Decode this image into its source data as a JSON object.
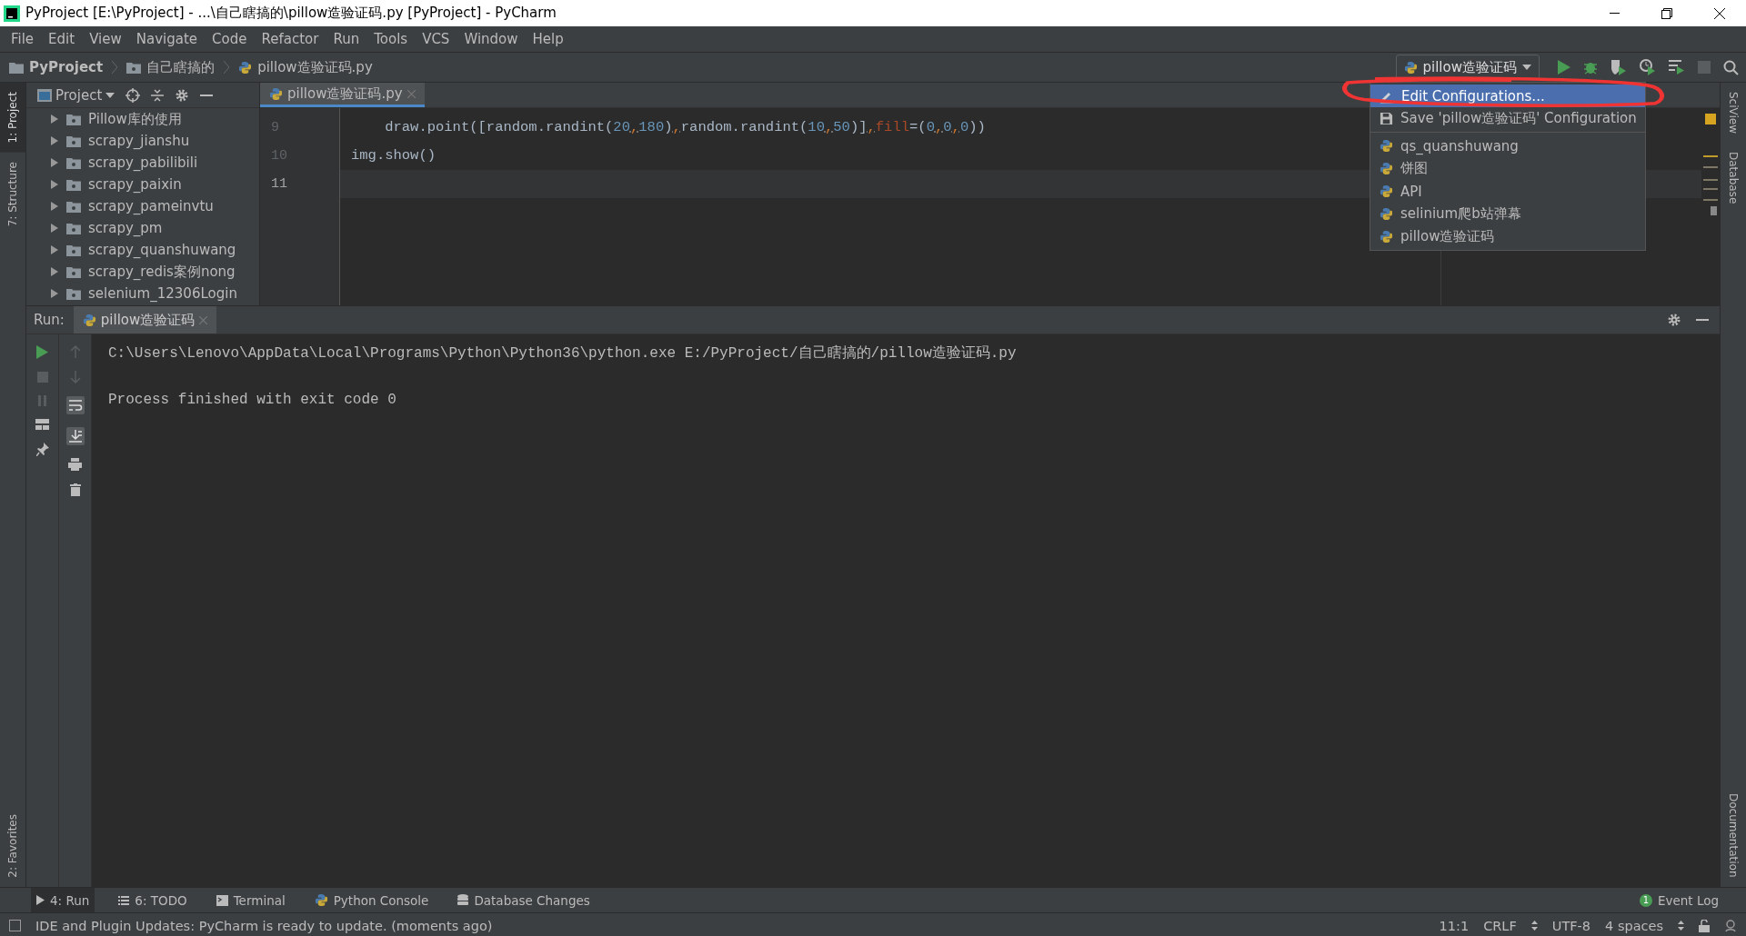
{
  "window": {
    "title": "PyProject [E:\\PyProject] - ...\\自己瞎搞的\\pillow造验证码.py [PyProject] - PyCharm"
  },
  "menu": [
    "File",
    "Edit",
    "View",
    "Navigate",
    "Code",
    "Refactor",
    "Run",
    "Tools",
    "VCS",
    "Window",
    "Help"
  ],
  "breadcrumb": [
    {
      "label": "PyProject",
      "kind": "project"
    },
    {
      "label": "自己瞎搞的",
      "kind": "folder"
    },
    {
      "label": "pillow造验证码.py",
      "kind": "file"
    }
  ],
  "run_config": {
    "label": "pillow造验证码"
  },
  "config_menu": [
    {
      "label": "Edit Configurations...",
      "kind": "edit",
      "selected": true
    },
    {
      "label": "Save 'pillow造验证码' Configuration",
      "kind": "save",
      "selected": false
    },
    {
      "label": "qs_quanshuwang",
      "kind": "config",
      "selected": false
    },
    {
      "label": "饼图",
      "kind": "config",
      "selected": false
    },
    {
      "label": "API",
      "kind": "config",
      "selected": false
    },
    {
      "label": "selinium爬b站弹幕",
      "kind": "config",
      "selected": false
    },
    {
      "label": "pillow造验证码",
      "kind": "config",
      "selected": false
    }
  ],
  "left_tools": [
    {
      "label": "1: Project",
      "selected": true,
      "kind": "top"
    },
    {
      "label": "7: Structure",
      "selected": false,
      "kind": "top"
    },
    {
      "label": "2: Favorites",
      "selected": false,
      "kind": "bottom"
    }
  ],
  "right_tools": [
    {
      "label": "SciView",
      "kind": "top"
    },
    {
      "label": "Database",
      "kind": "top"
    },
    {
      "label": "Documentation",
      "kind": "bottom"
    }
  ],
  "project_panel": {
    "title": "Project",
    "tree": [
      {
        "label": "Pillow库的使用",
        "expanded": false
      },
      {
        "label": "scrapy_jianshu",
        "expanded": false
      },
      {
        "label": "scrapy_pabilibili",
        "expanded": false
      },
      {
        "label": "scrapy_paixin",
        "expanded": false
      },
      {
        "label": "scrapy_pameinvtu",
        "expanded": false
      },
      {
        "label": "scrapy_pm",
        "expanded": false
      },
      {
        "label": "scrapy_quanshuwang",
        "expanded": false
      },
      {
        "label": "scrapy_redis案例nong",
        "expanded": false
      },
      {
        "label": "selenium_12306Login",
        "expanded": false
      }
    ]
  },
  "editor": {
    "tab": {
      "label": "pillow造验证码.py",
      "selected": true
    },
    "lines": [
      {
        "number": "9",
        "current": false,
        "tokens": [
          {
            "text": "    draw.point([random.randint(",
            "kind": "plain"
          },
          {
            "text": "20",
            "kind": "number"
          },
          {
            "text": ",",
            "kind": "comma"
          },
          {
            "text": "180",
            "kind": "number"
          },
          {
            "text": ")",
            "kind": "plain"
          },
          {
            "text": ",",
            "kind": "comma"
          },
          {
            "text": "random.randint(",
            "kind": "plain"
          },
          {
            "text": "10",
            "kind": "number"
          },
          {
            "text": ",",
            "kind": "comma"
          },
          {
            "text": "50",
            "kind": "number"
          },
          {
            "text": ")]",
            "kind": "plain"
          },
          {
            "text": ",",
            "kind": "comma"
          },
          {
            "text": "fill",
            "kind": "param"
          },
          {
            "text": "=(",
            "kind": "plain"
          },
          {
            "text": "0",
            "kind": "number"
          },
          {
            "text": ",",
            "kind": "comma"
          },
          {
            "text": "0",
            "kind": "number"
          },
          {
            "text": ",",
            "kind": "comma"
          },
          {
            "text": "0",
            "kind": "number"
          },
          {
            "text": "))",
            "kind": "plain"
          }
        ]
      },
      {
        "number": "10",
        "current": false,
        "tokens": [
          {
            "text": "img.show()",
            "kind": "plain"
          }
        ]
      },
      {
        "number": "11",
        "current": true
      }
    ]
  },
  "run_panel": {
    "label": "Run:",
    "tab": "pillow造验证码",
    "output": [
      {
        "text": "C:\\Users\\Lenovo\\AppData\\Local\\Programs\\Python\\Python36\\python.exe E:/PyProject/自己瞎搞的/pillow造验证码.py",
        "kind": "command"
      },
      {
        "text": "Process finished with exit code 0",
        "kind": "result"
      }
    ]
  },
  "bottom_tools": [
    {
      "label": "4: Run",
      "kind": "run",
      "selected": true
    },
    {
      "label": "6: TODO",
      "kind": "todo",
      "selected": false
    },
    {
      "label": "Terminal",
      "kind": "terminal",
      "selected": false
    },
    {
      "label": "Python Console",
      "kind": "console",
      "selected": false
    },
    {
      "label": "Database Changes",
      "kind": "database",
      "selected": false
    }
  ],
  "event_log": {
    "label": "Event Log",
    "count": "1"
  },
  "status_bar": {
    "message": "IDE and Plugin Updates: PyCharm is ready to update. (moments ago)",
    "position": "11:1",
    "line_separator": "CRLF",
    "encoding": "UTF-8",
    "indent": "4 spaces"
  }
}
